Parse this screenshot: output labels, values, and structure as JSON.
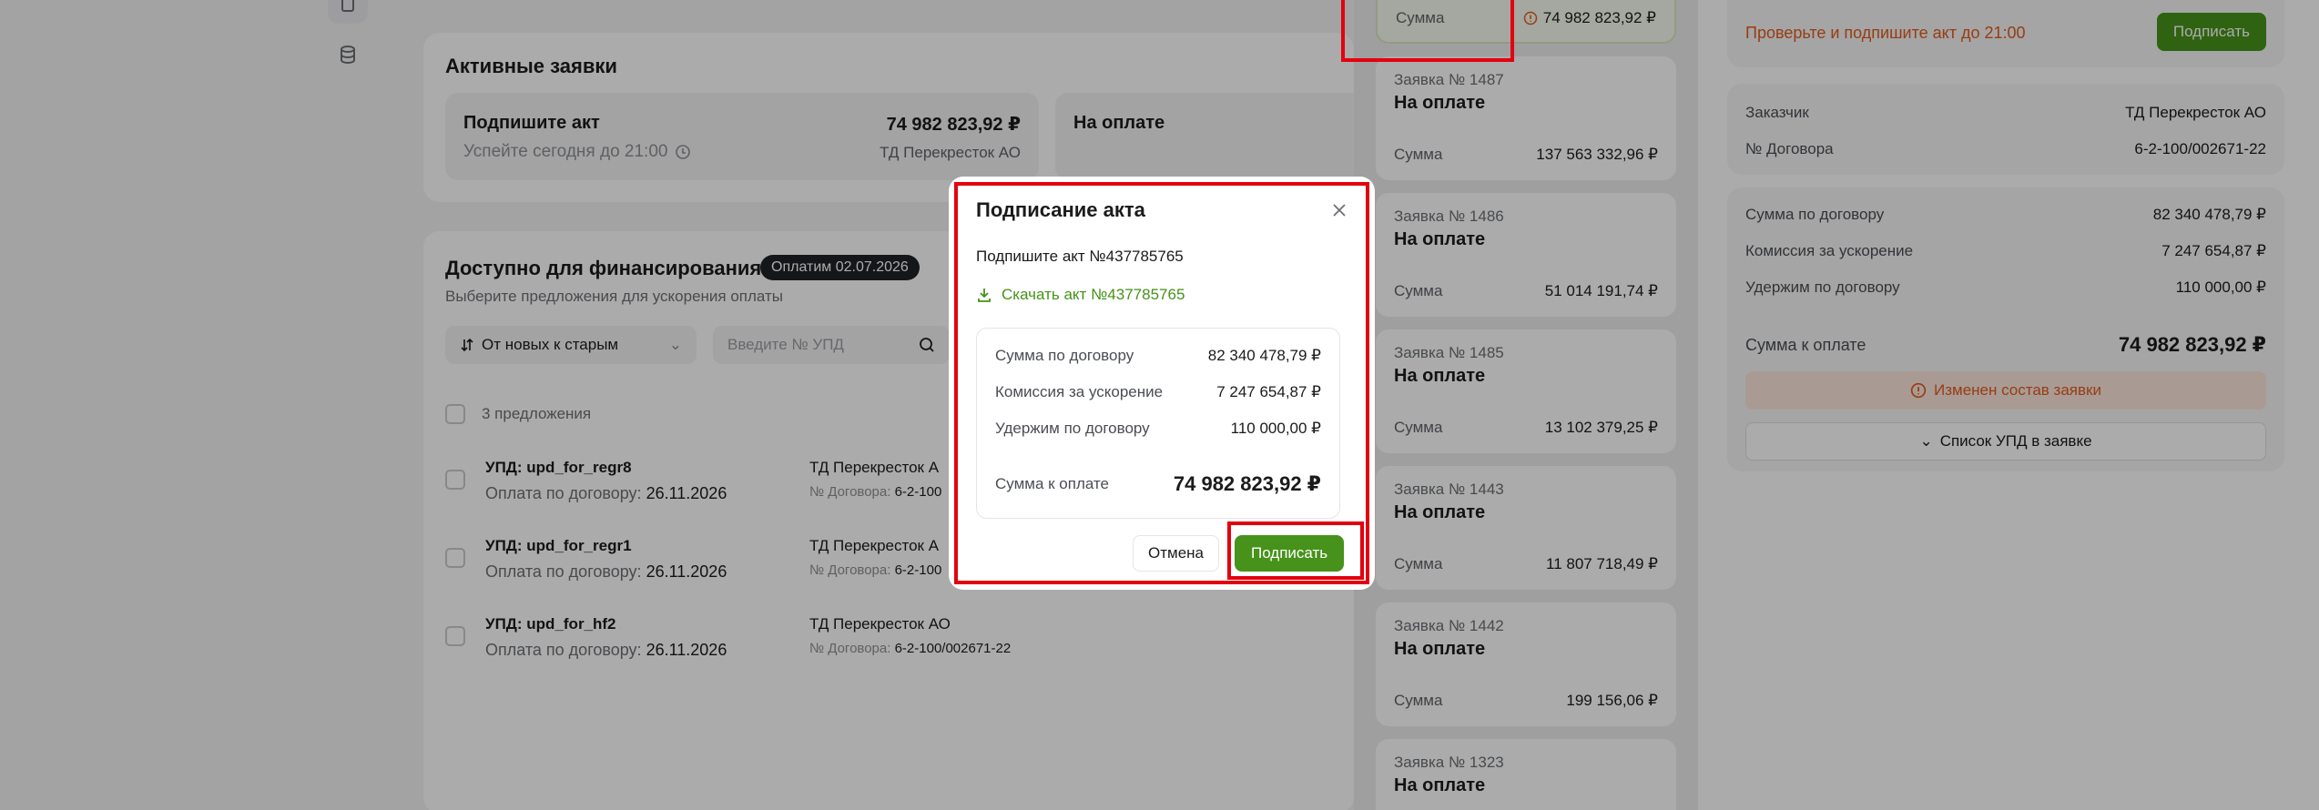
{
  "active": {
    "title": "Активные заявки",
    "tile1": {
      "heading": "Подпишите акт",
      "amount": "74 982 823,92 ₽",
      "deadline": "Успейте сегодня до 21:00",
      "client": "ТД Перекресток АО"
    },
    "tile2": {
      "heading": "На оплате"
    }
  },
  "available": {
    "title": "Доступно для финансирования",
    "badge": "Оплатим 02.07.2026",
    "description": "Выберите предложения для ускорения оплаты",
    "sort_label": "От новых к старым",
    "search_placeholder": "Введите  № УПД",
    "offers_count": "3 предложения",
    "rows": [
      {
        "title": "УПД: upd_for_regr8",
        "pay_label": "Оплата по договору:",
        "pay_date": "26.11.2026",
        "client": "ТД Перекресток А",
        "contract_label": "№ Договора:",
        "contract": "6-2-100"
      },
      {
        "title": "УПД: upd_for_regr1",
        "pay_label": "Оплата по договору:",
        "pay_date": "26.11.2026",
        "client": "ТД Перекресток А",
        "contract_label": "№ Договора:",
        "contract": "6-2-100"
      },
      {
        "title": "УПД: upd_for_hf2",
        "pay_label": "Оплата по договору:",
        "pay_date": "26.11.2026",
        "client": "ТД Перекресток АО",
        "contract_label": "№ Договора:",
        "contract": "6-2-100/002671-22"
      }
    ]
  },
  "requests": {
    "first": {
      "label": "Сумма",
      "value": "74 982 823,92 ₽"
    },
    "items": [
      {
        "number": "Заявка № 1487",
        "status": "На оплате",
        "label": "Сумма",
        "value": "137 563 332,96 ₽"
      },
      {
        "number": "Заявка № 1486",
        "status": "На оплате",
        "label": "Сумма",
        "value": "51 014 191,74 ₽"
      },
      {
        "number": "Заявка № 1485",
        "status": "На оплате",
        "label": "Сумма",
        "value": "13 102 379,25 ₽"
      },
      {
        "number": "Заявка № 1443",
        "status": "На оплате",
        "label": "Сумма",
        "value": "11 807 718,49 ₽"
      },
      {
        "number": "Заявка № 1442",
        "status": "На оплате",
        "label": "Сумма",
        "value": "199 156,06 ₽"
      },
      {
        "number": "Заявка № 1323",
        "status": "На оплате",
        "label": "",
        "value": ""
      }
    ]
  },
  "details": {
    "warning": "Проверьте и подпишите акт до 21:00",
    "sign_label": "Подписать",
    "customer_label": "Заказчик",
    "customer": "ТД Перекресток АО",
    "contract_label": "№ Договора",
    "contract": "6-2-100/002671-22",
    "contract_sum_label": "Сумма по договору",
    "contract_sum": "82 340 478,79 ₽",
    "fee_label": "Комиссия за ускорение",
    "fee": "7 247 654,87 ₽",
    "hold_label": "Удержим по договору",
    "hold": "110 000,00 ₽",
    "total_label": "Сумма к оплате",
    "total": "74 982 823,92 ₽",
    "changed": "Изменен состав заявки",
    "upd_list": "Список УПД в заявке"
  },
  "modal": {
    "title": "Подписание акта",
    "act": "Подпишите акт №437785765",
    "download": "Скачать акт №437785765",
    "contract_sum_label": "Сумма по договору",
    "contract_sum": "82 340 478,79 ₽",
    "fee_label": "Комиссия за ускорение",
    "fee": "7 247 654,87 ₽",
    "hold_label": "Удержим по договору",
    "hold": "110 000,00 ₽",
    "total_label": "Сумма к оплате",
    "total": "74 982 823,92 ₽",
    "cancel": "Отмена",
    "submit": "Подписать"
  },
  "colors": {
    "accent": "#46921a",
    "warning": "#e25a1c",
    "highlight": "#e3000f"
  },
  "icons": [
    "document-icon",
    "database-icon",
    "clock-icon",
    "sort-icon",
    "chevron-down-icon",
    "search-icon",
    "alert-icon",
    "close-icon",
    "download-icon"
  ]
}
